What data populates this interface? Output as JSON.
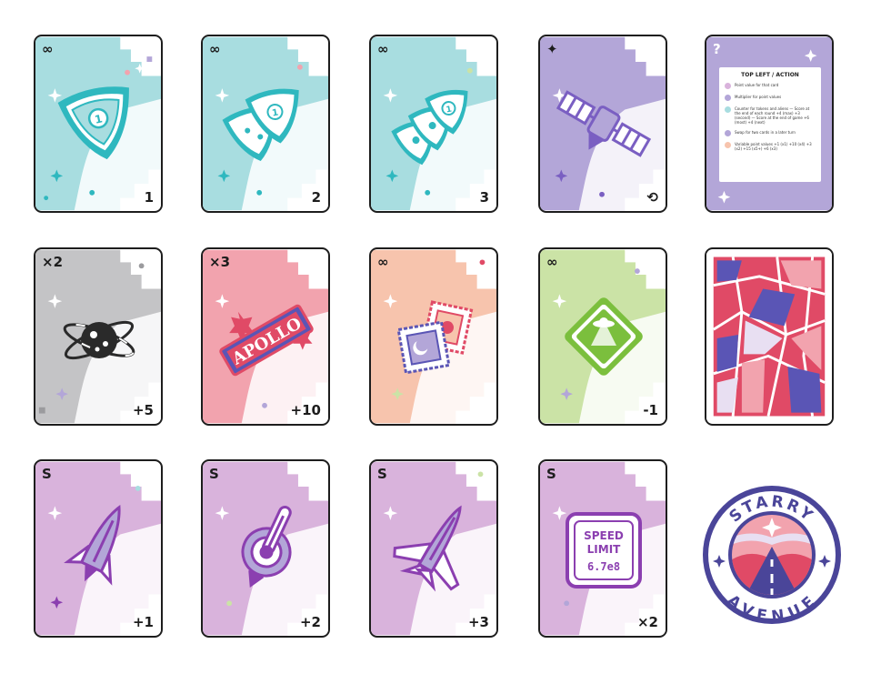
{
  "cards": [
    {
      "id": "c1",
      "top_left": "∞",
      "bottom_right": "1",
      "color": "#a8dde0",
      "art": "pick-1-icon"
    },
    {
      "id": "c2",
      "top_left": "∞",
      "bottom_right": "2",
      "color": "#a8dde0",
      "art": "pick-2-icon"
    },
    {
      "id": "c3",
      "top_left": "∞",
      "bottom_right": "3",
      "color": "#a8dde0",
      "art": "pick-3-icon"
    },
    {
      "id": "c4",
      "top_left": "✦",
      "bottom_right": "⟲",
      "color": "#b3a6d8",
      "art": "satellite-icon"
    },
    {
      "id": "c5",
      "top_left": "?",
      "bottom_right": "",
      "color": "#b3a6d8",
      "art": "rules-card"
    },
    {
      "id": "c6",
      "top_left": "×2",
      "bottom_right": "+5",
      "color": "#c4c4c6",
      "art": "planet-orbit-icon"
    },
    {
      "id": "c7",
      "top_left": "×3",
      "bottom_right": "+10",
      "color": "#f2a3ae",
      "art": "apollo-ticket-icon"
    },
    {
      "id": "c8",
      "top_left": "∞",
      "bottom_right": "",
      "color": "#f7c4ad",
      "art": "stamps-icon"
    },
    {
      "id": "c9",
      "top_left": "∞",
      "bottom_right": "-1",
      "color": "#cbe3a6",
      "art": "ufo-sign-icon"
    },
    {
      "id": "c10",
      "top_left": "",
      "bottom_right": "",
      "color": "#e5e5e5",
      "art": "card-back-pattern"
    },
    {
      "id": "c11",
      "top_left": "S",
      "bottom_right": "+1",
      "color": "#d9b3dc",
      "art": "rocket-icon"
    },
    {
      "id": "c12",
      "top_left": "S",
      "bottom_right": "+2",
      "color": "#d9b3dc",
      "art": "shuttle-wheel-icon"
    },
    {
      "id": "c13",
      "top_left": "S",
      "bottom_right": "+3",
      "color": "#d9b3dc",
      "art": "jet-icon"
    },
    {
      "id": "c14",
      "top_left": "S",
      "bottom_right": "×2",
      "color": "#d9b3dc",
      "art": "speed-limit-sign-icon"
    }
  ],
  "apollo_label": "APOLLO",
  "speed_sign": {
    "line1": "SPEED",
    "line2": "LIMIT",
    "line3": "6.7e8"
  },
  "rules": {
    "title": "TOP LEFT / ACTION",
    "items": [
      {
        "color": "#d9b3dc",
        "text": "Point value for that card"
      },
      {
        "color": "#b3a6d8",
        "text": "Multiplier for point values"
      },
      {
        "color": "#a8dde0",
        "text": "Counter for tokens and aliens — Score at the end of each round +4 (max) +3 (second) — Score at the end of game +6 (most) +4 (next)"
      },
      {
        "color": "#b3a6d8",
        "text": "Swap for two cards in a later turn"
      },
      {
        "color": "#f7c4ad",
        "text": "Variable point values +1 (x1) +10 (x4) +3 (x2) +15 (x5+) +6 (x3)"
      }
    ]
  },
  "logo": {
    "top": "STARRY",
    "bottom": "AVENUE"
  },
  "colors": {
    "ink": "#1d1d1d",
    "teal": "#2fb8bf",
    "violet": "#7a5fc2",
    "purple": "#8b3fb0",
    "red": "#e04a66",
    "green": "#7bbf3d",
    "navy": "#4a4599"
  }
}
